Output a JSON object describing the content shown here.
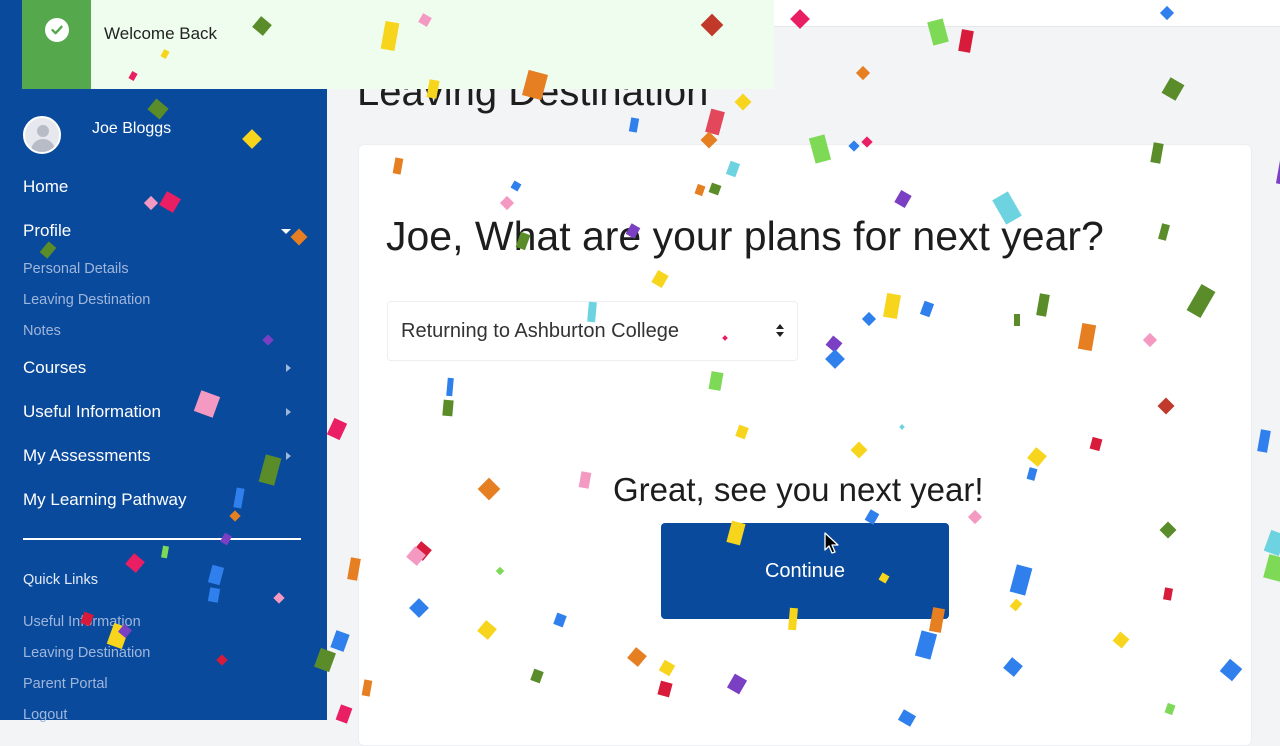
{
  "toast": {
    "message": "Welcome Back"
  },
  "user": {
    "name": "Joe Bloggs"
  },
  "nav": {
    "home": "Home",
    "profile": "Profile",
    "profile_sub": [
      "Personal Details",
      "Leaving Destination",
      "Notes"
    ],
    "courses": "Courses",
    "useful_information": "Useful Information",
    "my_assessments": "My Assessments",
    "my_learning_pathway": "My Learning Pathway"
  },
  "quick_links": {
    "title": "Quick Links",
    "items": [
      "Useful Information",
      "Leaving Destination",
      "Parent Portal",
      "Logout"
    ]
  },
  "page": {
    "title": "Leaving Destination",
    "question": "Joe, What are your plans for next year?",
    "selected_option": "Returning to Ashburton College",
    "confirmation": "Great, see you next year!",
    "continue_label": "Continue"
  },
  "colors": {
    "sidebar": "#0a4a9c",
    "toast_bg": "#effdee",
    "toast_accent": "#55a84c",
    "button": "#0a4a9c"
  }
}
